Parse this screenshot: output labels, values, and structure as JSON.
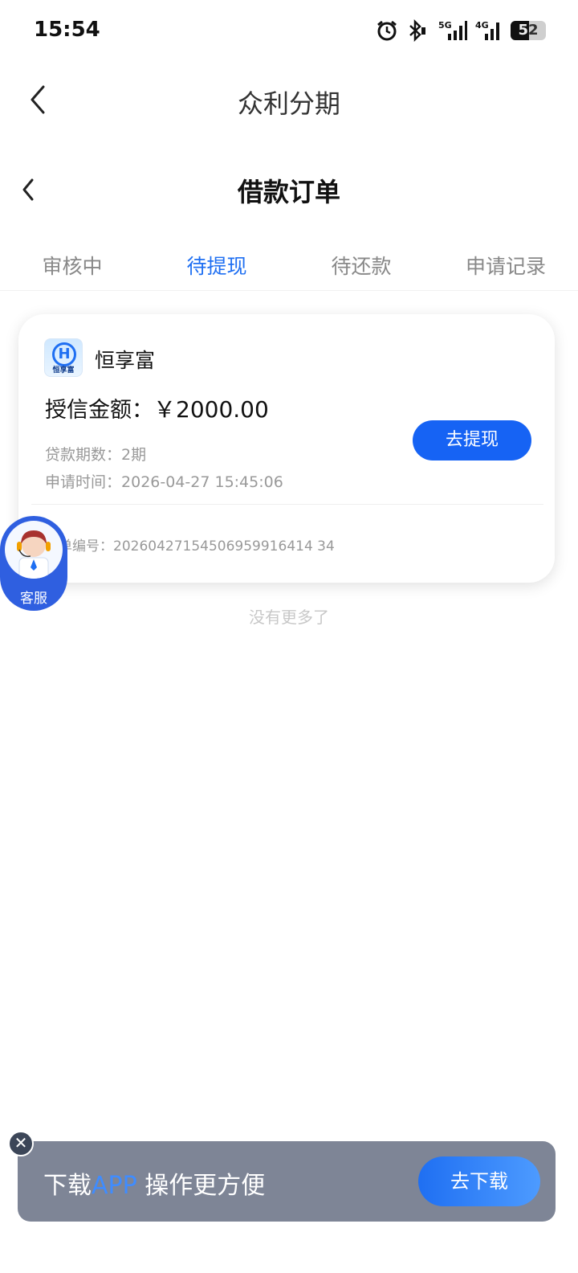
{
  "status_bar": {
    "time": "15:54",
    "battery": "52",
    "battery_level": 0.52,
    "icons": [
      "alarm-icon",
      "bluetooth-icon",
      "signal-5g-icon",
      "signal-4g-icon",
      "battery-icon"
    ]
  },
  "app_header": {
    "title": "众利分期",
    "back_icon": "chevron-left-icon"
  },
  "page_header": {
    "title": "借款订单",
    "back_icon": "chevron-left-icon"
  },
  "tabs": [
    {
      "label": "审核中",
      "active": false
    },
    {
      "label": "待提现",
      "active": true
    },
    {
      "label": "待还款",
      "active": false
    },
    {
      "label": "申请记录",
      "active": false
    }
  ],
  "order": {
    "brand_name": "恒享富",
    "logo_letter": "H",
    "logo_sub": "恒享富",
    "credit_label": "授信金额：",
    "credit_amount": "￥2000.00",
    "period_label": "贷款期数：",
    "period_value": "2期",
    "applied_label": "申请时间：",
    "applied_value": "2026-04-27 15:45:06",
    "withdraw_button": "去提现",
    "order_no_label": "单编号：",
    "order_no_value": "20260427154506959916414 34"
  },
  "no_more": "没有更多了",
  "customer_service": {
    "label": "客服"
  },
  "download_banner": {
    "text_prefix": "下载",
    "text_highlight": "APP",
    "text_suffix": " 操作更方便",
    "button": "去下载",
    "close_icon": "close-icon"
  },
  "colors": {
    "accent": "#1f6ff2",
    "button": "#1663f4",
    "banner_bg": "#5a6378"
  }
}
